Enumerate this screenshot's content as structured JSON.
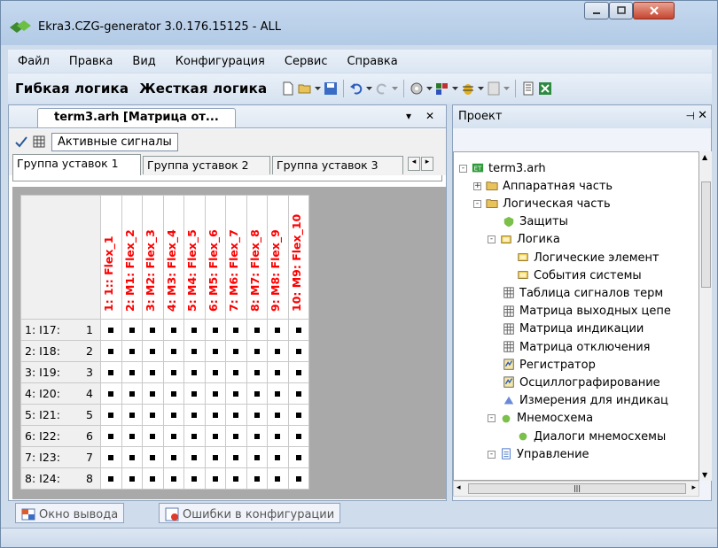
{
  "window": {
    "title": "Ekra3.CZG-generator 3.0.176.15125 - ALL"
  },
  "menu": [
    "Файл",
    "Правка",
    "Вид",
    "Конфигурация",
    "Сервис",
    "Справка"
  ],
  "toolbar": {
    "flex_logic": "Гибкая логика",
    "hard_logic": "Жесткая логика"
  },
  "document": {
    "tab_title": "term3.arh [Матрица от...",
    "active_signals": "Активные сигналы",
    "group_tabs": [
      "Группа уставок 1",
      "Группа уставок 2",
      "Группа уставок 3"
    ],
    "columns": [
      "1: 1:: Flex_1",
      "2: M1: Flex_2",
      "3: M2: Flex_3",
      "4: M3: Flex_4",
      "5: M4: Flex_5",
      "6: M5: Flex_6",
      "7: M6: Flex_7",
      "8: M7: Flex_8",
      "9: M8: Flex_9",
      "10: M9: Flex_10"
    ],
    "rows": [
      {
        "name": "1: I17:",
        "num": "1"
      },
      {
        "name": "2: I18:",
        "num": "2"
      },
      {
        "name": "3: I19:",
        "num": "3"
      },
      {
        "name": "4: I20:",
        "num": "4"
      },
      {
        "name": "5: I21:",
        "num": "5"
      },
      {
        "name": "6: I22:",
        "num": "6"
      },
      {
        "name": "7: I23:",
        "num": "7"
      },
      {
        "name": "8: I24:",
        "num": "8"
      }
    ]
  },
  "project": {
    "title": "Проект",
    "tree": [
      {
        "label": "term3.arh"
      },
      {
        "label": "Аппаратная часть"
      },
      {
        "label": "Логическая часть"
      },
      {
        "label": "Защиты"
      },
      {
        "label": "Логика"
      },
      {
        "label": "Логические элемент"
      },
      {
        "label": "События системы"
      },
      {
        "label": "Таблица сигналов терм"
      },
      {
        "label": "Матрица выходных цепе"
      },
      {
        "label": "Матрица индикации"
      },
      {
        "label": "Матрица отключения"
      },
      {
        "label": "Регистратор"
      },
      {
        "label": "Осциллографирование"
      },
      {
        "label": "Измерения для индикац"
      },
      {
        "label": "Мнемосхема"
      },
      {
        "label": "Диалоги мнемосхемы"
      },
      {
        "label": "Управление"
      }
    ]
  },
  "bottom_tabs": [
    "Окно вывода",
    "Ошибки в конфигурации"
  ],
  "colors": {
    "column_label": "#ff0000",
    "titlebar": "#b3cbe6",
    "close_button": "#c6452f"
  }
}
